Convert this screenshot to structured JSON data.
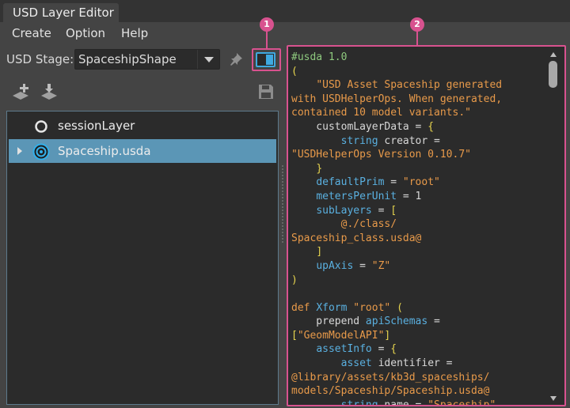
{
  "window": {
    "tab_title": "USD Layer Editor"
  },
  "menu": {
    "items": [
      "Create",
      "Option",
      "Help"
    ]
  },
  "stage": {
    "label": "USD Stage:",
    "value": "SpaceshipShape"
  },
  "callouts": {
    "one": "1",
    "two": "2"
  },
  "colors": {
    "accent": "#3fa9e0",
    "highlight": "#d8528f",
    "selection": "#5b96b6"
  },
  "icons": {
    "pin": "pin-icon",
    "toggle": "panel-toggle-icon",
    "add_layer": "add-layer-icon",
    "load_layer": "load-layer-icon",
    "save": "save-icon",
    "session": "session-layer-icon",
    "root": "root-layer-icon"
  },
  "layers": [
    {
      "name": "sessionLayer",
      "selected": false
    },
    {
      "name": "Spaceship.usda",
      "selected": true
    }
  ],
  "code": [
    [
      [
        "c-comment",
        "#usda 1.0"
      ]
    ],
    [
      [
        "c-punct",
        "("
      ]
    ],
    [
      [
        "c-plain",
        "    "
      ],
      [
        "c-str",
        "\"USD Asset Spaceship generated"
      ]
    ],
    [
      [
        "c-str",
        "with USDHelperOps. When generated,"
      ]
    ],
    [
      [
        "c-str",
        "contained 10 model variants.\""
      ]
    ],
    [
      [
        "c-plain",
        "    customLayerData = "
      ],
      [
        "c-punct",
        "{"
      ]
    ],
    [
      [
        "c-plain",
        "        "
      ],
      [
        "c-type",
        "string"
      ],
      [
        "c-plain",
        " creator = "
      ]
    ],
    [
      [
        "c-str",
        "\"USDHelperOps Version 0.10.7\""
      ]
    ],
    [
      [
        "c-plain",
        "    "
      ],
      [
        "c-punct",
        "}"
      ]
    ],
    [
      [
        "c-plain",
        "    "
      ],
      [
        "c-key",
        "defaultPrim"
      ],
      [
        "c-plain",
        " = "
      ],
      [
        "c-str",
        "\"root\""
      ]
    ],
    [
      [
        "c-plain",
        "    "
      ],
      [
        "c-key",
        "metersPerUnit"
      ],
      [
        "c-plain",
        " = 1"
      ]
    ],
    [
      [
        "c-plain",
        "    "
      ],
      [
        "c-key",
        "subLayers"
      ],
      [
        "c-plain",
        " = "
      ],
      [
        "c-punct",
        "["
      ]
    ],
    [
      [
        "c-plain",
        "        "
      ],
      [
        "c-str",
        "@./class/"
      ]
    ],
    [
      [
        "c-str",
        "Spaceship_class.usda@"
      ]
    ],
    [
      [
        "c-plain",
        "    "
      ],
      [
        "c-punct",
        "]"
      ]
    ],
    [
      [
        "c-plain",
        "    "
      ],
      [
        "c-key",
        "upAxis"
      ],
      [
        "c-plain",
        " = "
      ],
      [
        "c-str",
        "\"Z\""
      ]
    ],
    [
      [
        "c-punct",
        ")"
      ]
    ],
    [
      [
        "c-plain",
        ""
      ]
    ],
    [
      [
        "c-kw",
        "def"
      ],
      [
        "c-plain",
        " "
      ],
      [
        "c-key",
        "Xform"
      ],
      [
        "c-plain",
        " "
      ],
      [
        "c-str",
        "\"root\""
      ],
      [
        "c-plain",
        " "
      ],
      [
        "c-punct",
        "("
      ]
    ],
    [
      [
        "c-plain",
        "    prepend "
      ],
      [
        "c-key",
        "apiSchemas"
      ],
      [
        "c-plain",
        " = "
      ]
    ],
    [
      [
        "c-punct",
        "["
      ],
      [
        "c-str",
        "\"GeomModelAPI\""
      ],
      [
        "c-punct",
        "]"
      ]
    ],
    [
      [
        "c-plain",
        "    "
      ],
      [
        "c-key",
        "assetInfo"
      ],
      [
        "c-plain",
        " = "
      ],
      [
        "c-punct",
        "{"
      ]
    ],
    [
      [
        "c-plain",
        "        "
      ],
      [
        "c-type",
        "asset"
      ],
      [
        "c-plain",
        " identifier = "
      ]
    ],
    [
      [
        "c-str",
        "@library/assets/kb3d_spaceships/"
      ]
    ],
    [
      [
        "c-str",
        "models/Spaceship/Spaceship.usda@"
      ]
    ],
    [
      [
        "c-plain",
        "        "
      ],
      [
        "c-type",
        "string"
      ],
      [
        "c-plain",
        " name = "
      ],
      [
        "c-str",
        "\"Spaceship\""
      ]
    ]
  ]
}
